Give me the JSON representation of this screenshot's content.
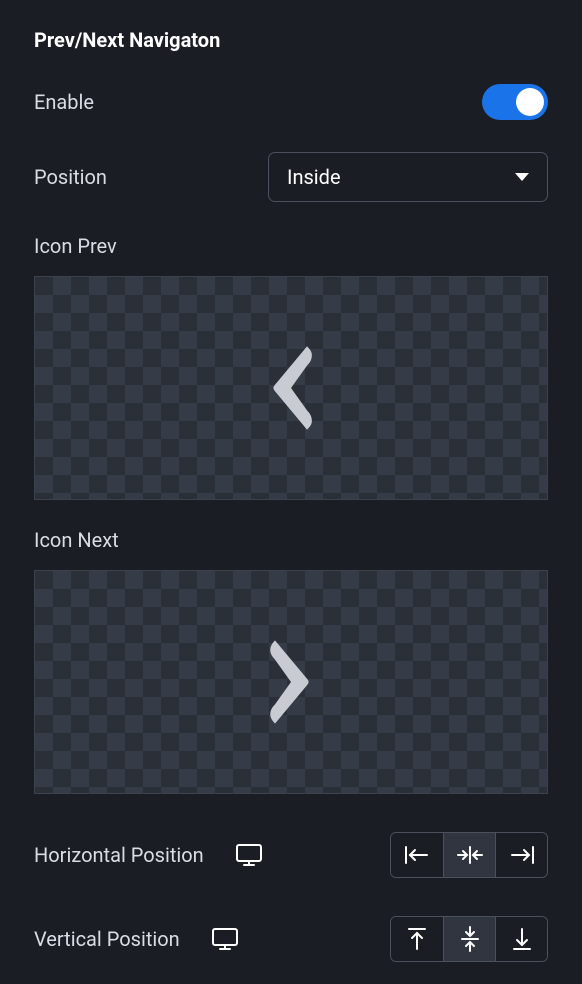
{
  "section": {
    "title": "Prev/Next Navigaton"
  },
  "enable": {
    "label": "Enable",
    "value": true
  },
  "position": {
    "label": "Position",
    "value": "Inside"
  },
  "iconPrev": {
    "label": "Icon Prev",
    "glyph": "chevron-left"
  },
  "iconNext": {
    "label": "Icon Next",
    "glyph": "chevron-right"
  },
  "hpos": {
    "label": "Horizontal Position",
    "options": [
      "left",
      "center",
      "right"
    ],
    "value": "center"
  },
  "vpos": {
    "label": "Vertical Position",
    "options": [
      "top",
      "middle",
      "bottom"
    ],
    "value": "middle"
  }
}
